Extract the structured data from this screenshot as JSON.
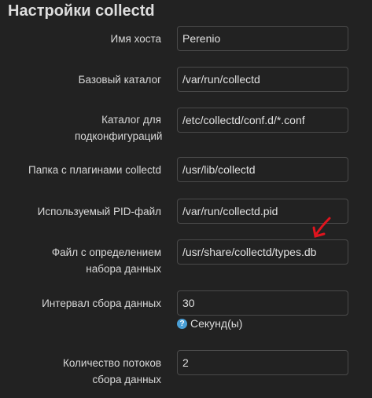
{
  "title": "Настройки collectd",
  "fields": [
    {
      "label": "Имя хоста",
      "value": "Perenio"
    },
    {
      "label": "Базовый каталог",
      "value": "/var/run/collectd"
    },
    {
      "label": "Каталог для подконфигураций",
      "value": "/etc/collectd/conf.d/*.conf"
    },
    {
      "label": "Папка с плагинами collectd",
      "value": "/usr/lib/collectd"
    },
    {
      "label": "Используемый PID-файл",
      "value": "/var/run/collectd.pid"
    },
    {
      "label": "Файл с определением набора данных",
      "value": "/usr/share/collectd/types.db"
    },
    {
      "label": "Интервал сбора данных",
      "value": "30"
    },
    {
      "label": "Количество потоков сбора данных",
      "value": "2"
    }
  ],
  "interval_help": "Секунд(ы)",
  "annotation_color": "#e0141e"
}
